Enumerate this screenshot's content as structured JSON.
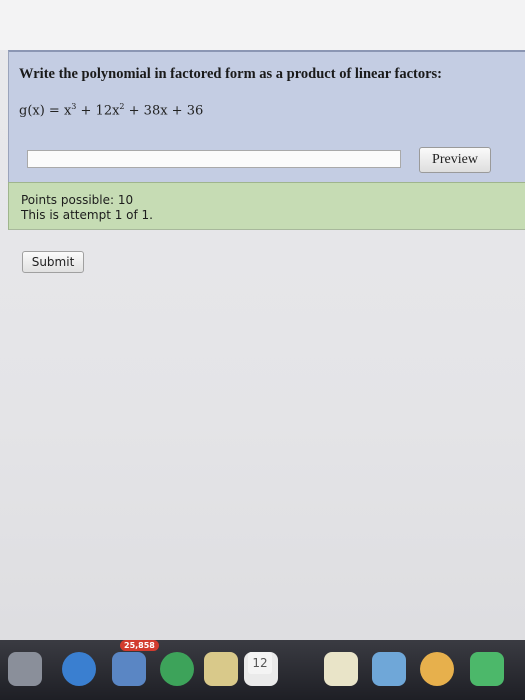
{
  "question": {
    "prompt": "Write the polynomial in factored form as a product of linear factors:",
    "formula_lhs": "g(x) = x",
    "formula_exp1": "3",
    "formula_mid": " + 12x",
    "formula_exp2": "2",
    "formula_rhs": " + 38x + 36",
    "answer_value": "",
    "preview_label": "Preview"
  },
  "info": {
    "points_line": "Points possible: 10",
    "attempt_line": "This is attempt 1 of 1."
  },
  "actions": {
    "submit_label": "Submit"
  },
  "dock": {
    "badge": "25,858",
    "calendar_day": "12",
    "icons": [
      "launchpad-icon",
      "safari-icon",
      "mail-icon",
      "chrome-icon",
      "notes-icon",
      "calendar-icon",
      "reminders-icon",
      "appstore-icon",
      "photos-icon",
      "messages-icon"
    ]
  }
}
